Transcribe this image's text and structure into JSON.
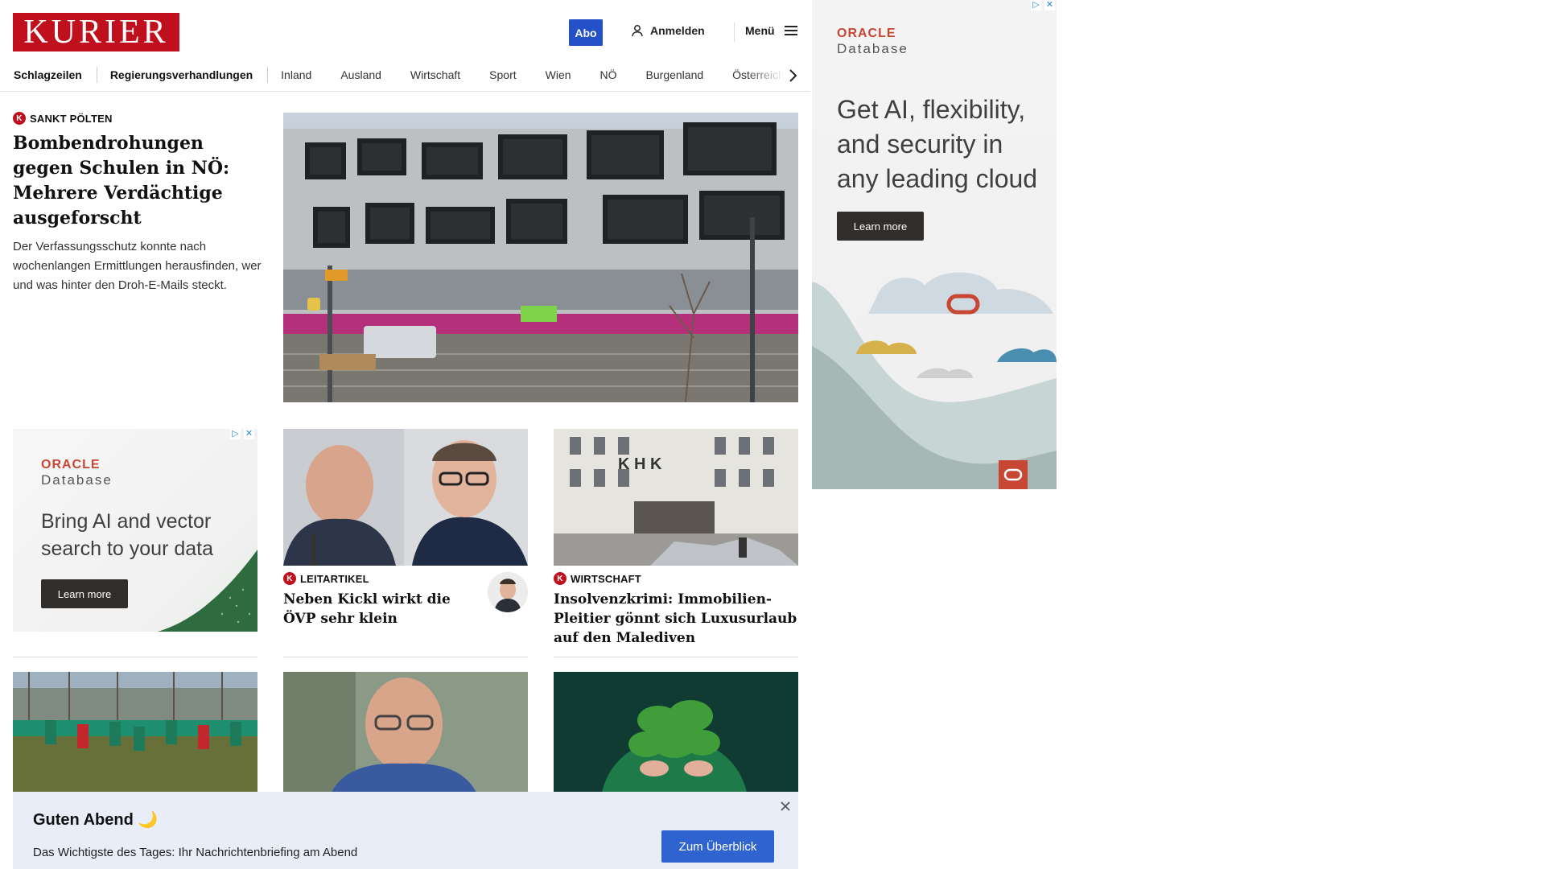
{
  "header": {
    "logo": "KURIER",
    "abo_label": "Abo",
    "login_label": "Anmelden",
    "menu_label": "Menü"
  },
  "nav": {
    "items": [
      "Schlagzeilen",
      "Regierungsverhandlungen",
      "Inland",
      "Ausland",
      "Wirtschaft",
      "Sport",
      "Wien",
      "NÖ",
      "Burgenland",
      "Österreich"
    ]
  },
  "lead": {
    "kicker": "SANKT PÖLTEN",
    "title": "Bombendrohungen gegen Schulen in NÖ: Mehrere Verdächtige ausgeforscht",
    "teaser": "Der Verfassungsschutz konnte nach wochenlangen Ermittlungen herausfinden, wer und was hinter den Droh-E-Mails steckt."
  },
  "ad_small": {
    "brand_top": "ORACLE",
    "brand_bottom": "Database",
    "copy": "Bring AI and vector search to your data",
    "button": "Learn more"
  },
  "ad_big": {
    "brand_top": "ORACLE",
    "brand_bottom": "Database",
    "copy": "Get AI, flexibility, and security in any leading cloud",
    "button": "Learn more"
  },
  "teasers": [
    {
      "kicker": "LEITARTIKEL",
      "title": "Neben Kickl wirkt die ÖVP sehr klein"
    },
    {
      "kicker": "WIRTSCHAFT",
      "title": "Insolvenzkrimi: Immobilien-Pleitier gönnt sich Luxusurlaub auf den Malediven"
    }
  ],
  "banner": {
    "title": "Guten Abend 🌙",
    "text": "Das Wichtigste des Tages: Ihr Nachrichtenbriefing am Abend",
    "button": "Zum Überblick"
  },
  "colors": {
    "brand_red": "#c0101e",
    "abo_blue": "#2451c7",
    "oracle_red": "#c74634",
    "banner_bg": "#e8edf7",
    "cta_blue": "#2f63cf"
  }
}
